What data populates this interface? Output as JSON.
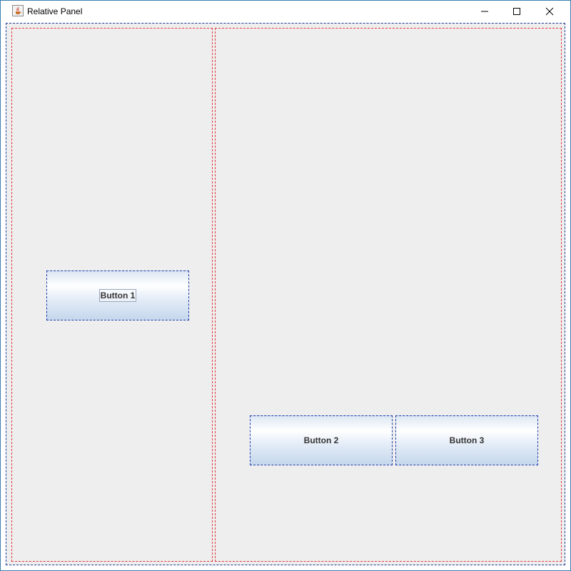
{
  "window": {
    "title": "Relative Panel",
    "controls": {
      "minimize": "minimize-icon",
      "maximize": "maximize-icon",
      "close": "close-icon"
    }
  },
  "buttons": {
    "button1": "Button 1",
    "button2": "Button 2",
    "button3": "Button 3"
  },
  "colors": {
    "content_background": "#eeeeee",
    "panel_border": "#e0393f",
    "content_border": "#1f3c96",
    "button_border": "#1f3ca8"
  }
}
